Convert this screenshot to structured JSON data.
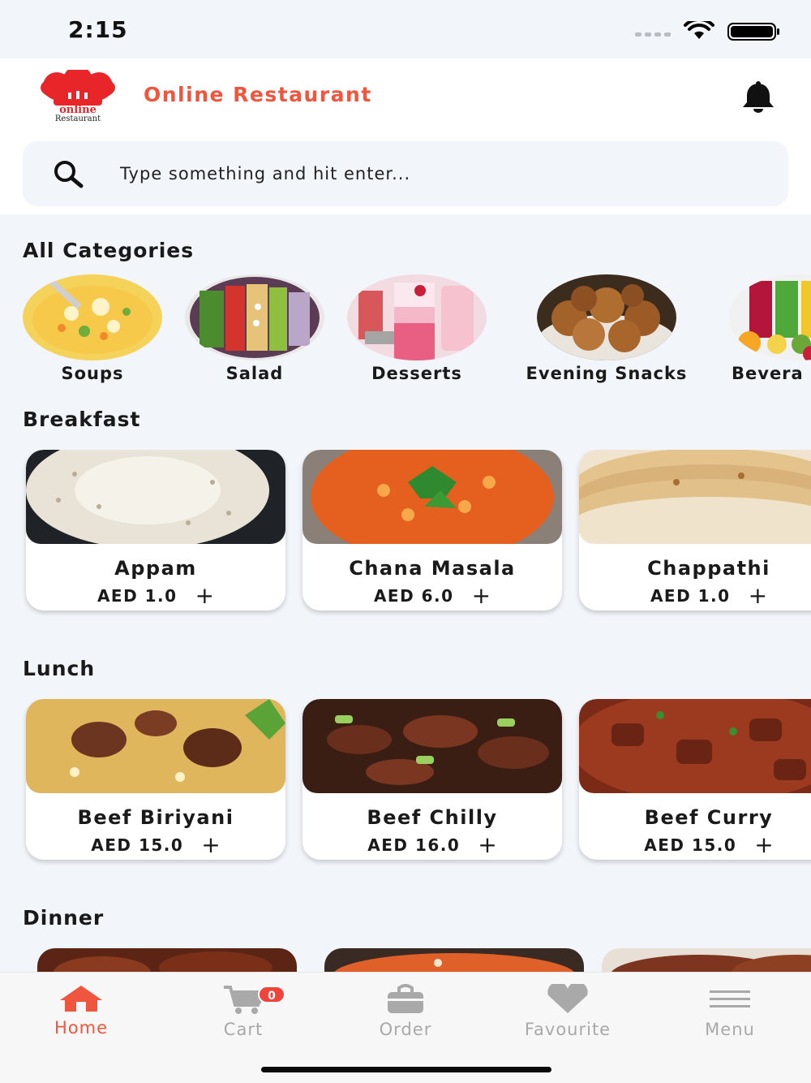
{
  "status_bar": {
    "time": "2:15"
  },
  "header": {
    "title": "Online Restaurant",
    "logo_text": "Online Restaurant"
  },
  "search": {
    "placeholder": "Type something and hit enter..."
  },
  "categories": {
    "title": "All Categories",
    "items": [
      {
        "label": "Soups"
      },
      {
        "label": "Salad"
      },
      {
        "label": "Desserts"
      },
      {
        "label": "Evening Snacks"
      },
      {
        "label": "Bevera"
      }
    ]
  },
  "breakfast": {
    "title": "Breakfast",
    "items": [
      {
        "name": "Appam",
        "price": "AED 1.0"
      },
      {
        "name": "Chana Masala",
        "price": "AED 6.0"
      },
      {
        "name": "Chappathi",
        "price": "AED 1.0"
      }
    ]
  },
  "lunch": {
    "title": "Lunch",
    "items": [
      {
        "name": "Beef Biriyani",
        "price": "AED 15.0"
      },
      {
        "name": "Beef Chilly",
        "price": "AED 16.0"
      },
      {
        "name": "Beef Curry",
        "price": "AED 15.0"
      }
    ]
  },
  "dinner": {
    "title": "Dinner"
  },
  "add_symbol": "+",
  "tabbar": {
    "home": "Home",
    "cart": "Cart",
    "cart_count": "0",
    "order": "Order",
    "favourite": "Favourite",
    "menu": "Menu"
  },
  "colors": {
    "accent": "#f0553e",
    "background": "#f2f5fa",
    "inactive": "#a9a9a9"
  }
}
